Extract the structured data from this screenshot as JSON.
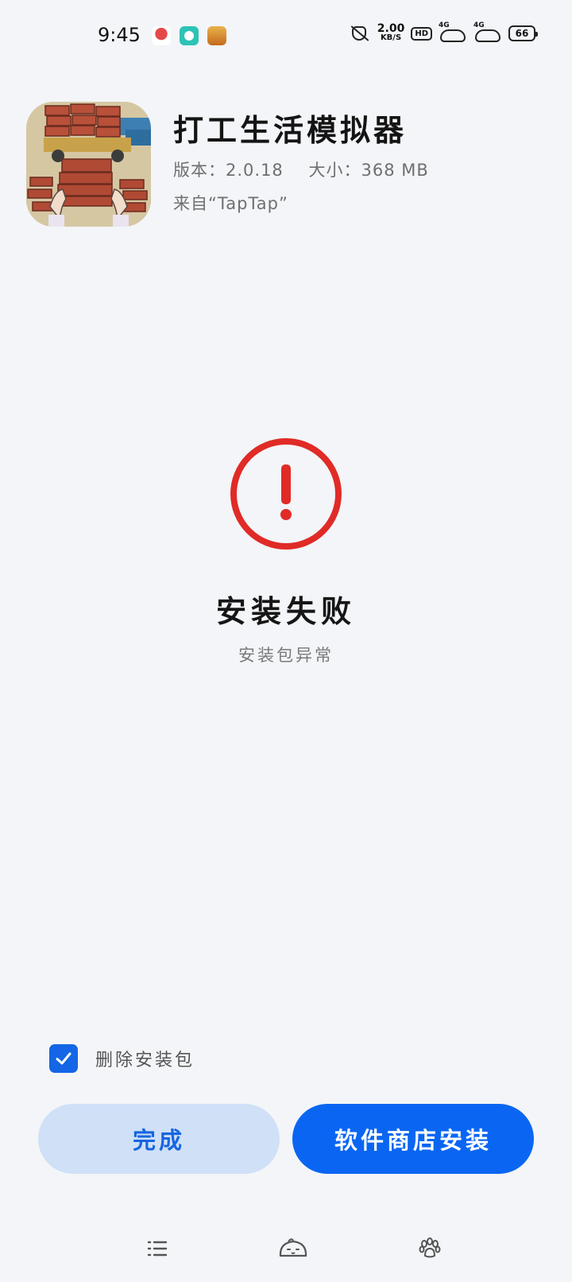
{
  "status_bar": {
    "time": "9:45",
    "net_speed_value": "2.00",
    "net_speed_unit": "KB/S",
    "hd_label": "HD",
    "signal1_label": "4G",
    "signal2_label": "4G",
    "battery_level": "66"
  },
  "app": {
    "name": "打工生活模拟器",
    "version": "版本：2.0.18",
    "size": "大小：368 MB",
    "source": "来自“TapTap”"
  },
  "result": {
    "title": "安装失败",
    "subtitle": "安装包异常",
    "icon": "error-exclamation-icon",
    "icon_color": "#e02b27"
  },
  "options": {
    "delete_package_label": "删除安装包",
    "delete_package_checked": true
  },
  "buttons": {
    "done_label": "完成",
    "store_install_label": "软件商店安装"
  },
  "nav": {
    "items": [
      "menu-icon",
      "home-face-icon",
      "back-paw-icon"
    ]
  },
  "colors": {
    "primary": "#0a66f2",
    "secondary_bg": "#cfe0f7",
    "error": "#e02b27",
    "background": "#f3f5f8"
  }
}
